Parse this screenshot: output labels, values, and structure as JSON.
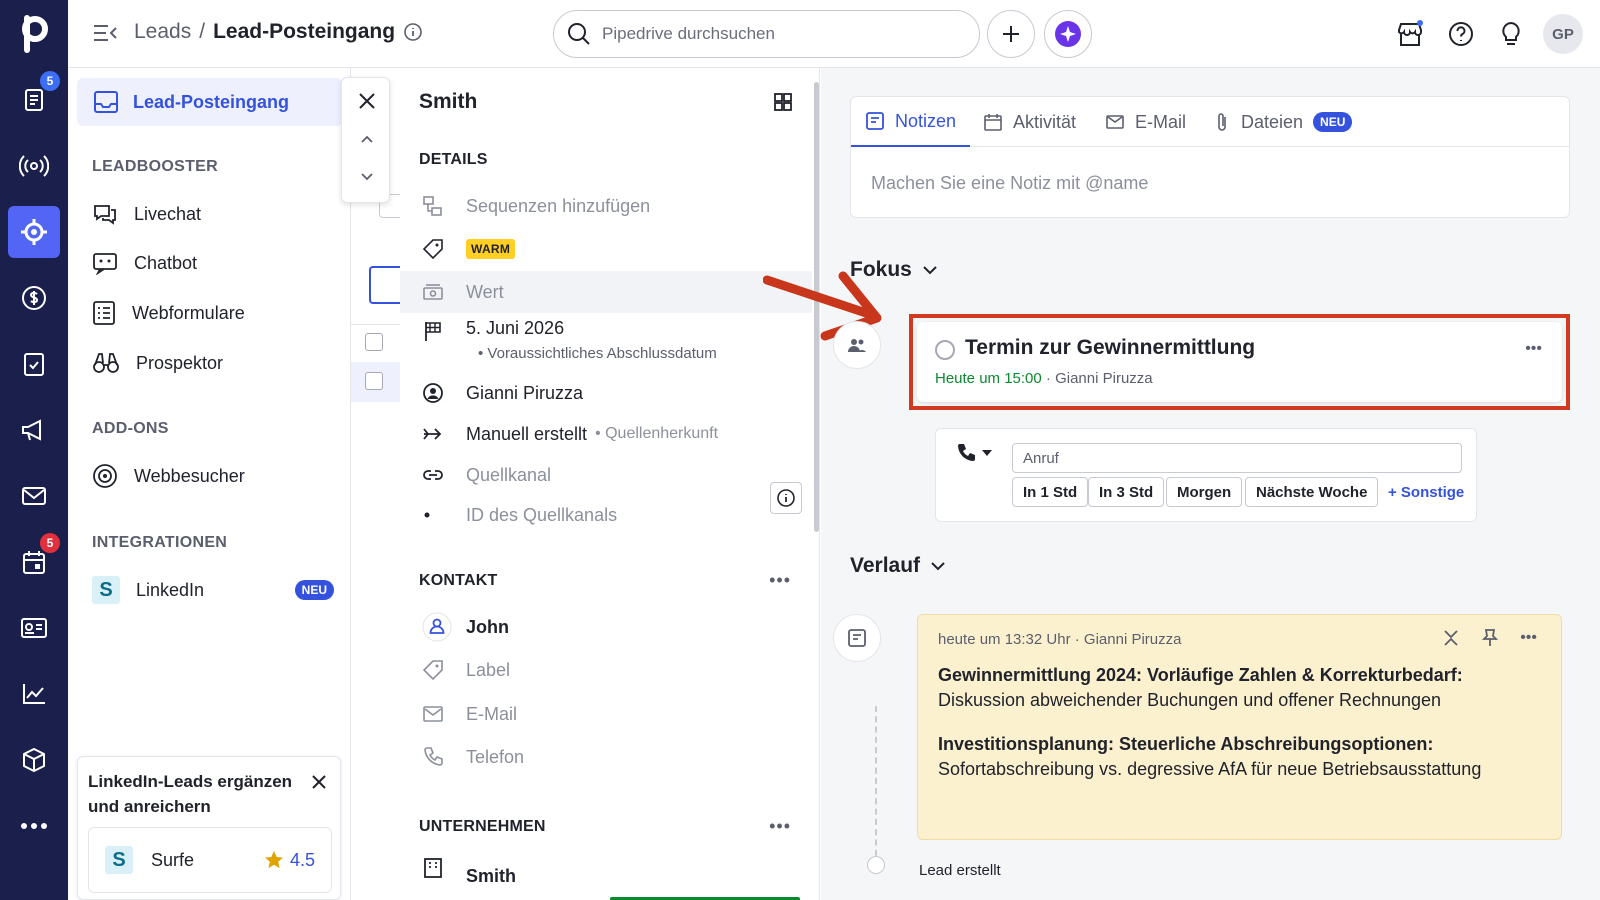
{
  "header": {
    "breadcrumb_parent": "Leads",
    "breadcrumb_sep": "/",
    "breadcrumb_current": "Lead-Posteingang",
    "search_placeholder": "Pipedrive durchsuchen",
    "avatar_initials": "GP"
  },
  "rail": {
    "logo": "p",
    "badges": {
      "leads": "5",
      "activities": "5"
    },
    "colors": {
      "bg": "#1a1f4b",
      "active": "#5265f5",
      "badge_blue": "#3b6df5",
      "badge_red": "#e0303e"
    }
  },
  "sidemenu": {
    "active_item": "Lead-Posteingang",
    "section_leadbooster": "LEADBOOSTER",
    "items_leadbooster": [
      "Livechat",
      "Chatbot",
      "Webformulare",
      "Prospektor"
    ],
    "section_addons": "ADD-ONS",
    "items_addons": [
      "Webbesucher"
    ],
    "section_integrations": "INTEGRATIONEN",
    "integration_item": "LinkedIn",
    "integration_badge": "NEU",
    "promo": {
      "title": "LinkedIn-Leads ergänzen und anreichern",
      "app_letter": "S",
      "app_name": "Surfe",
      "rating": "4.5"
    }
  },
  "details": {
    "title": "Smith",
    "section_details": "DETAILS",
    "sequences": "Sequenzen hinzufügen",
    "label_tag": "WARM",
    "value": "Wert",
    "close_date": "5. Juni 2026",
    "close_date_sub": "Voraussichtliches Abschlussdatum",
    "owner": "Gianni Piruzza",
    "source_origin": "Manuell erstellt",
    "source_origin_sub": "Quellenherkunft",
    "source_channel": "Quellkanal",
    "source_channel_id": "ID des Quellkanals",
    "section_contact": "KONTAKT",
    "contact_name": "John",
    "contact_label": "Label",
    "contact_email": "E-Mail",
    "contact_phone": "Telefon",
    "section_company": "UNTERNEHMEN",
    "company_name": "Smith"
  },
  "right": {
    "tabs": {
      "notes": "Notizen",
      "activity": "Aktivität",
      "email": "E-Mail",
      "files": "Dateien",
      "files_badge": "NEU"
    },
    "note_placeholder": "Machen Sie eine Notiz mit @name",
    "focus_heading": "Fokus",
    "focus_activity": {
      "title": "Termin zur Gewinnermittlung",
      "time": "Heute um 15:00",
      "separator": "·",
      "owner": "Gianni Piruzza"
    },
    "call": {
      "input_value": "Anruf",
      "quick_1": "In 1 Std",
      "quick_2": "In 3 Std",
      "quick_3": "Morgen",
      "quick_4": "Nächste Woche",
      "quick_more": "+ Sonstige"
    },
    "history_heading": "Verlauf",
    "note": {
      "meta": "heute um 13:32 Uhr · Gianni Piruzza",
      "p1_bold": "Gewinnermittlung 2024: Vorläufige Zahlen & Korrekturbedarf:",
      "p1_text": " Diskussion abweichender Buchungen und offener Rechnungen",
      "p2_bold": "Investitionsplanung: Steuerliche Abschreibungsoptionen:",
      "p2_text": " Sofortabschreibung vs. degressive AfA für neue Betriebsausstattung"
    },
    "lead_created": "Lead erstellt",
    "colors": {
      "highlight_box": "#d23a1f",
      "arrow": "#c8361c",
      "time_green": "#0c8a2f",
      "note_bg": "#fcf1cf"
    }
  }
}
